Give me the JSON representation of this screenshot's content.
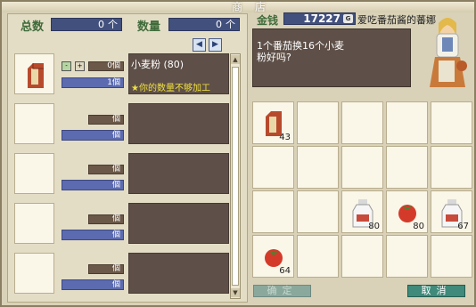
{
  "window": {
    "title": "商店"
  },
  "header": {
    "total_label": "总数",
    "total_value": "0",
    "total_unit": "个",
    "qty_label": "数量",
    "qty_value": "0",
    "qty_unit": "个"
  },
  "items": [
    {
      "qty": "0",
      "unit": "1",
      "name": "小麦粉 (80)",
      "warning": "★你的数量不够加工",
      "has_icon": true
    },
    {
      "qty": "",
      "unit": "",
      "name": "",
      "warning": ""
    },
    {
      "qty": "",
      "unit": "",
      "name": "",
      "warning": ""
    },
    {
      "qty": "",
      "unit": "",
      "name": "",
      "warning": ""
    },
    {
      "qty": "",
      "unit": "",
      "name": "",
      "warning": ""
    }
  ],
  "qty_unit_glyph": "個",
  "unit_unit_glyph": "個",
  "gold": {
    "label": "金钱",
    "value": "17227",
    "currency": "G"
  },
  "npc": {
    "name": "爱吃番茄酱的蕃娜",
    "dialog_line1": "1个番茄换16个小麦",
    "dialog_line2": "粉好吗?"
  },
  "grid": [
    {
      "icon": "flour-bag-icon",
      "count": "43"
    },
    {
      "icon": "",
      "count": ""
    },
    {
      "icon": "",
      "count": ""
    },
    {
      "icon": "",
      "count": ""
    },
    {
      "icon": "",
      "count": ""
    },
    {
      "icon": "",
      "count": ""
    },
    {
      "icon": "",
      "count": ""
    },
    {
      "icon": "",
      "count": ""
    },
    {
      "icon": "",
      "count": ""
    },
    {
      "icon": "",
      "count": ""
    },
    {
      "icon": "",
      "count": ""
    },
    {
      "icon": "",
      "count": ""
    },
    {
      "icon": "milk-bottle-icon",
      "count": "80"
    },
    {
      "icon": "tomato-icon",
      "count": "80"
    },
    {
      "icon": "milk-bottle-icon",
      "count": "67"
    },
    {
      "icon": "tomato-icon",
      "count": "64"
    },
    {
      "icon": "",
      "count": ""
    },
    {
      "icon": "",
      "count": ""
    },
    {
      "icon": "",
      "count": ""
    },
    {
      "icon": "",
      "count": ""
    }
  ],
  "buttons": {
    "confirm": "确定",
    "cancel": "取消"
  },
  "colors": {
    "panel_bg": "#e4ddc6",
    "accent_green": "#3f6b3a",
    "value_box": "#42507d",
    "text_box": "#5e5048",
    "warning": "#f0e040"
  }
}
